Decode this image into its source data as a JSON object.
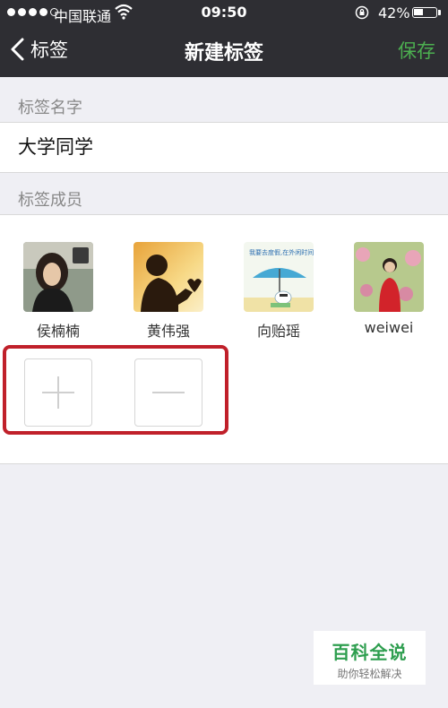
{
  "status_bar": {
    "carrier": "中国联通",
    "time": "09:50",
    "battery_percent": "42%",
    "battery_level": 0.42
  },
  "nav": {
    "back_label": "标签",
    "title": "新建标签",
    "save_label": "保存",
    "save_color": "#4caf50"
  },
  "form": {
    "name_section_label": "标签名字",
    "name_value": "大学同学",
    "members_section_label": "标签成员"
  },
  "members": [
    {
      "name": "侯楠楠"
    },
    {
      "name": "黄伟强"
    },
    {
      "name": "向贻瑶"
    },
    {
      "name": "weiwei"
    }
  ],
  "member3_avatar_text": "我要去度假,在外闲时间请联系",
  "icons": {
    "add": "plus-icon",
    "remove": "minus-icon",
    "back": "chevron-left-icon"
  },
  "highlight_color": "#c0202a",
  "watermark": {
    "title": "百科全说",
    "subtitle": "助你轻松解决"
  }
}
